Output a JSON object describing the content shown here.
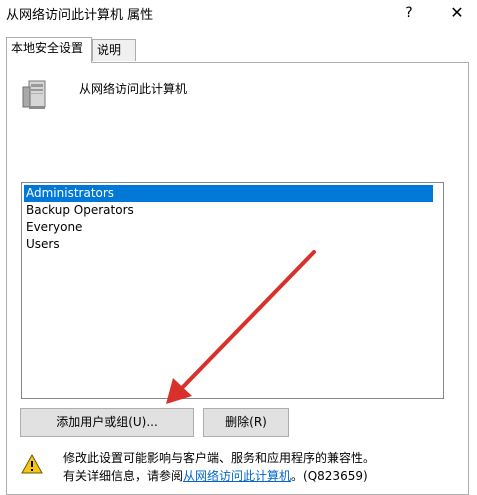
{
  "window": {
    "title": "从网络访问此计算机 属性",
    "help_label": "?",
    "close_label": "✕"
  },
  "tabs": [
    {
      "label": "本地安全设置",
      "active": true
    },
    {
      "label": "说明",
      "active": false
    }
  ],
  "policy": {
    "name": "从网络访问此计算机",
    "icon": "computer-tower-icon"
  },
  "accounts": {
    "items": [
      {
        "label": "Administrators",
        "selected": true
      },
      {
        "label": "Backup Operators",
        "selected": false
      },
      {
        "label": "Everyone",
        "selected": false
      },
      {
        "label": "Users",
        "selected": false
      }
    ]
  },
  "buttons": {
    "add_label": "添加用户或组(U)...",
    "remove_label": "删除(R)"
  },
  "warning": {
    "icon": "warning-icon",
    "line1": "修改此设置可能影响与客户端、服务和应用程序的兼容性。",
    "line2_prefix": "有关详细信息，请参阅",
    "link_text": "从网络访问此计算机",
    "line2_suffix": "。(Q823659)"
  },
  "colors": {
    "selection": "#0078d7",
    "link": "#0066cc",
    "annotation_arrow": "#d9302c"
  }
}
